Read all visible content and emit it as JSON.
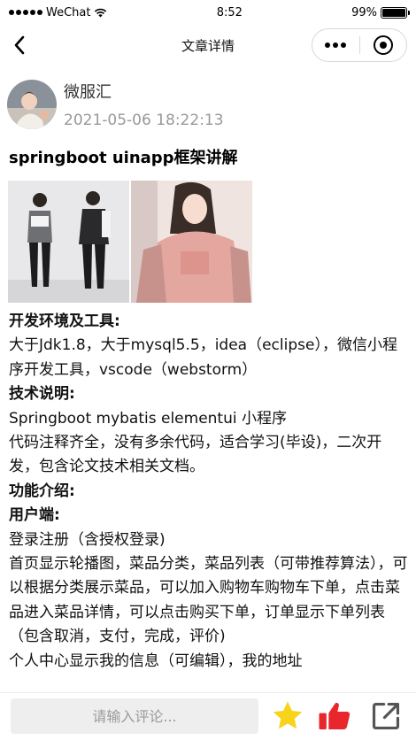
{
  "status_bar": {
    "carrier": "WeChat",
    "time": "8:52",
    "battery": "99%",
    "battery_level": 0.99
  },
  "nav": {
    "title": "文章详情"
  },
  "author": {
    "name": "微服汇",
    "time": "2021-05-06 18:22:13"
  },
  "article": {
    "title": "springboot uinapp框架讲解",
    "paragraphs": [
      {
        "text": "开发环境及工具:",
        "bold": true
      },
      {
        "text": "大于Jdk1.8，大于mysql5.5，idea（eclipse），微信小程序开发工具，vscode（webstorm）",
        "bold": false
      },
      {
        "text": "技术说明:",
        "bold": true
      },
      {
        "text": "Springboot mybatis elementui 小程序",
        "bold": false
      },
      {
        "text": "代码注释齐全，没有多余代码，适合学习(毕设)，二次开发，包含论文技术相关文档。",
        "bold": false
      },
      {
        "text": "功能介绍:",
        "bold": true
      },
      {
        "text": "用户端:",
        "bold": true
      },
      {
        "text": "登录注册（含授权登录)",
        "bold": false
      },
      {
        "text": "首页显示轮播图，菜品分类，菜品列表（可带推荐算法），可以根据分类展示菜品，可以加入购物车购物车下单，点击菜品进入菜品详情，可以点击购买下单，订单显示下单列表（包含取消，支付，完成，评价)",
        "bold": false
      },
      {
        "text": "个人中心显示我的信息（可编辑），我的地址",
        "bold": false
      }
    ]
  },
  "bottom": {
    "comment_placeholder": "请输入评论..."
  },
  "icons": {
    "back": "chevron-left-icon",
    "more": "more-dots-icon",
    "close": "mini-program-close-icon",
    "star": "star-icon",
    "like": "thumbs-up-icon",
    "share": "share-icon"
  },
  "colors": {
    "star": "#f7d31a",
    "like": "#e8262b",
    "muted": "#999999",
    "input_bg": "#eeeeee"
  }
}
